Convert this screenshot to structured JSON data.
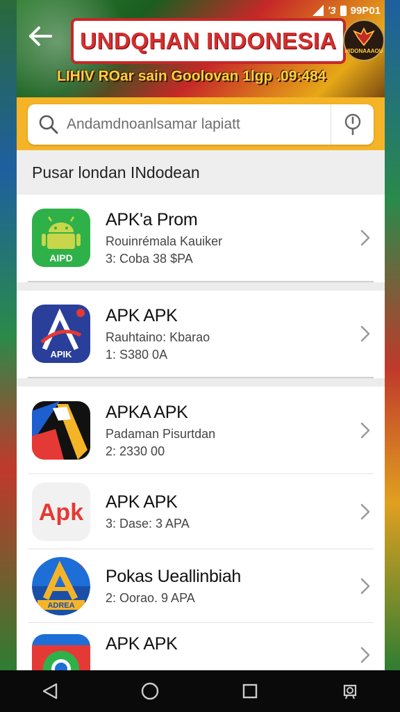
{
  "status_bar": {
    "text": "↘ Ⅱ ▮ 99P01",
    "time": "99P01"
  },
  "banner": {
    "title": "UNDQHAN INDONESIA",
    "subtitle": "LIHIV ROar sain Goolovan 1lgp .09:484",
    "emblem_text": "HIDONAAAOU"
  },
  "search": {
    "placeholder": "Andamdnoanlsamar lapiatt"
  },
  "section": {
    "title": "Pusar londan INdodean"
  },
  "apps": [
    {
      "name": "APK'a Prom",
      "line2": "Rouinrémala Kauiker",
      "line3": "3: Coba 38 $PA",
      "icon": "android-icon",
      "icon_label": "AIPD"
    },
    {
      "name": "APK APK",
      "line2": "Rauhtaino: Kbarao",
      "line3": "1: S380 0A",
      "icon": "apk-a-icon",
      "icon_label": "APIK"
    },
    {
      "name": "APKA APK",
      "line2": "Padaman Pisurtdan",
      "line3": "2: 2330 00",
      "icon": "ribbon-icon",
      "icon_label": ""
    },
    {
      "name": "APK APK",
      "line2": "3: Dase: 3 APA",
      "line3": "",
      "icon": "apk-text-icon",
      "icon_label": "Apk"
    },
    {
      "name": "Pokas Ueallinbiah",
      "line2": "2: Oorao. 9 APA",
      "line3": "",
      "icon": "a-circle-icon",
      "icon_label": "ADREA"
    },
    {
      "name": "APK APK",
      "line2": "",
      "line3": "",
      "icon": "chrome-like-icon",
      "icon_label": ""
    }
  ],
  "nav": {
    "back": "back",
    "home": "home",
    "recents": "recents",
    "extra": "assistant"
  },
  "colors": {
    "accent": "#f5b427",
    "title_red": "#d32f2f",
    "subtitle_yellow": "#ffd23f"
  }
}
